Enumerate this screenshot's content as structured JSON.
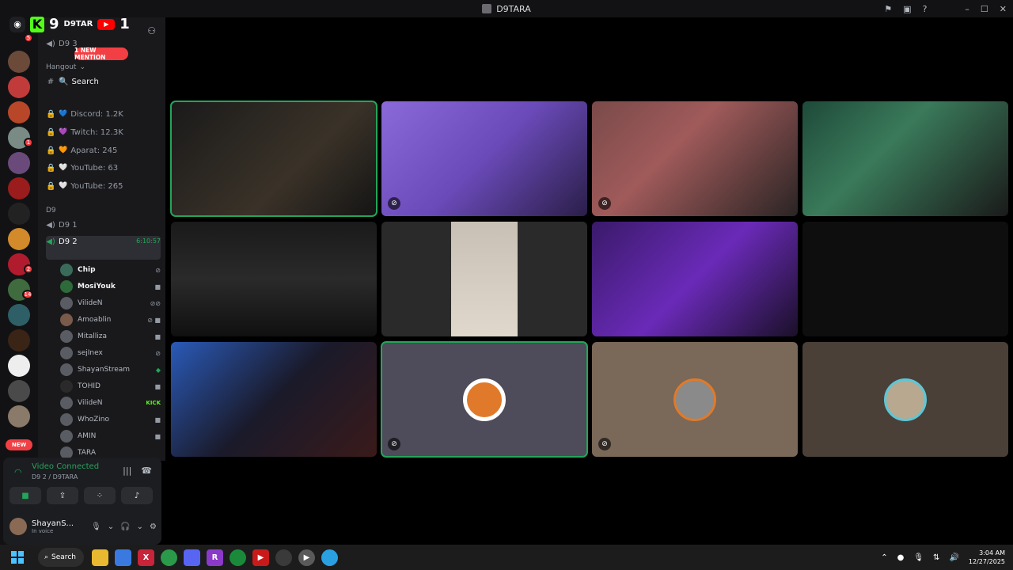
{
  "window": {
    "title": "D9TARA"
  },
  "overlay": {
    "kick_count": "9",
    "youtube_count": "1",
    "name": "D9TAR"
  },
  "server_rail": {
    "discord_badge": "5",
    "badges": [
      "1",
      "2",
      "14"
    ],
    "new_label": "NEW"
  },
  "sidebar": {
    "mention_pill": "1 NEW MENTION",
    "partial_top": "D9 3",
    "hangout_label": "Hangout",
    "search_channel": "Search",
    "locked_channels": [
      {
        "icon": "💙",
        "label": "Discord: 1.2K"
      },
      {
        "icon": "💜",
        "label": "Twitch: 12.3K"
      },
      {
        "icon": "🧡",
        "label": "Aparat: 245"
      },
      {
        "icon": "🤍",
        "label": "YouTube: 63"
      },
      {
        "icon": "🤍",
        "label": "YouTube: 265"
      }
    ],
    "category_d9": "D9",
    "voice_d91": "D9 1",
    "voice_d92": "D9 2",
    "voice_d92_timer": "6:10:57",
    "users": [
      {
        "name": "Chip",
        "bold": true
      },
      {
        "name": "MosiYouk",
        "bold": true
      },
      {
        "name": "VilideN",
        "bold": false
      },
      {
        "name": "Amoablin",
        "bold": false
      },
      {
        "name": "Mitalliza",
        "bold": false
      },
      {
        "name": "sejInex",
        "bold": false
      },
      {
        "name": "ShayanStream",
        "bold": false
      },
      {
        "name": "TOHID",
        "bold": false
      },
      {
        "name": "VilideN",
        "bold": false,
        "tag": "KICK"
      },
      {
        "name": "WhoZino",
        "bold": false
      },
      {
        "name": "AMIN",
        "bold": false
      },
      {
        "name": "TARA",
        "bold": false
      }
    ]
  },
  "voice_panel": {
    "status": "Video Connected",
    "location": "D9 2 / D9TARA",
    "user_name": "ShayanS...",
    "user_status": "In voice"
  },
  "taskbar": {
    "search_label": "Search",
    "time": "3:04 AM",
    "date": "12/27/2025",
    "app_icons": [
      "file-explorer-icon",
      "store-icon",
      "x-icon",
      "chrome-icon",
      "discord-icon",
      "r-app-icon",
      "xbox-icon",
      "youtube-icon",
      "obs-icon",
      "media-player-icon",
      "telegram-icon"
    ]
  },
  "colors": {
    "accent_green": "#23a55a",
    "mention_red": "#f23f43",
    "kick_green": "#53fc18",
    "bg_dark": "#121214"
  }
}
